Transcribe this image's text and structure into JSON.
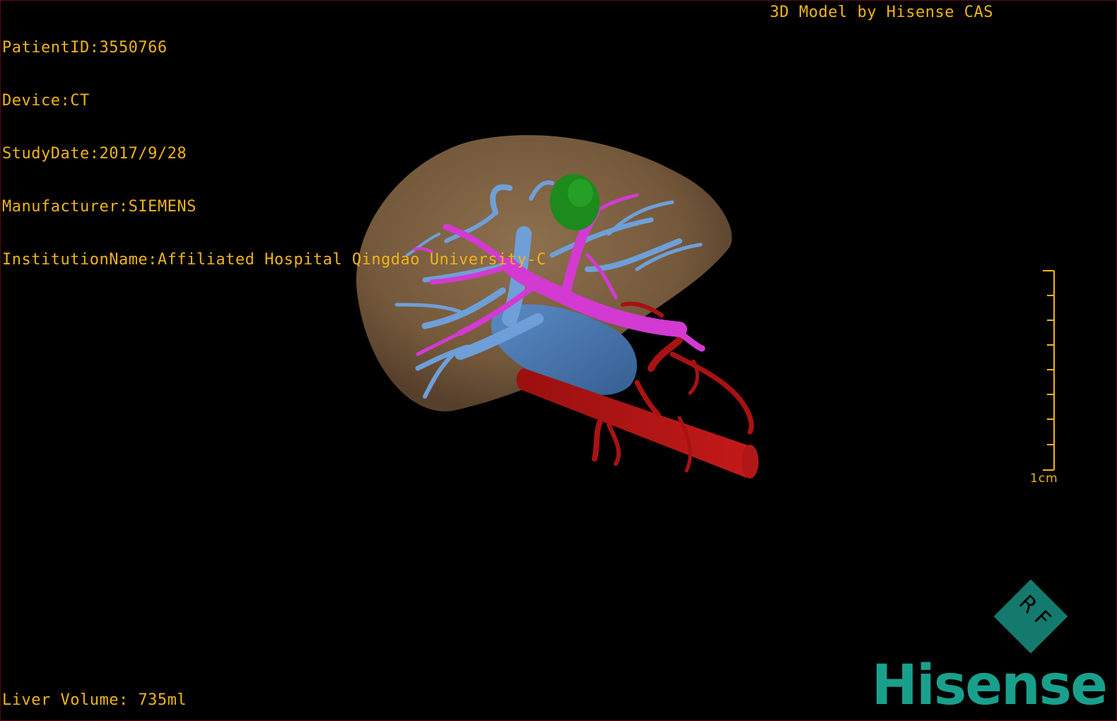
{
  "patient_info": {
    "patient_id": "PatientID:3550766",
    "device": "Device:CT",
    "study_date": "StudyDate:2017/9/28",
    "manufacturer": "Manufacturer:SIEMENS",
    "institution": "InstitutionName:Affiliated Hospital Qingdao University-C"
  },
  "credit": "3D Model by Hisense CAS",
  "liver_volume": "Liver Volume: 735ml",
  "scale_bar": {
    "label": "1cm"
  },
  "brand": {
    "name": "Hisense",
    "badge": "RF"
  },
  "colors": {
    "overlay_text": "#f0b419",
    "liver": "#8a6a48",
    "hepatic_veins": "#6f9fd8",
    "portal_vein": "#d23ad2",
    "arteries": "#b01414",
    "ivc": "#4a78b0",
    "gallbladder": "#1c8a1c",
    "brand": "#19a08c"
  },
  "icons": [
    "liver-3d-model",
    "scale-bar",
    "hisense-rf-logo"
  ]
}
